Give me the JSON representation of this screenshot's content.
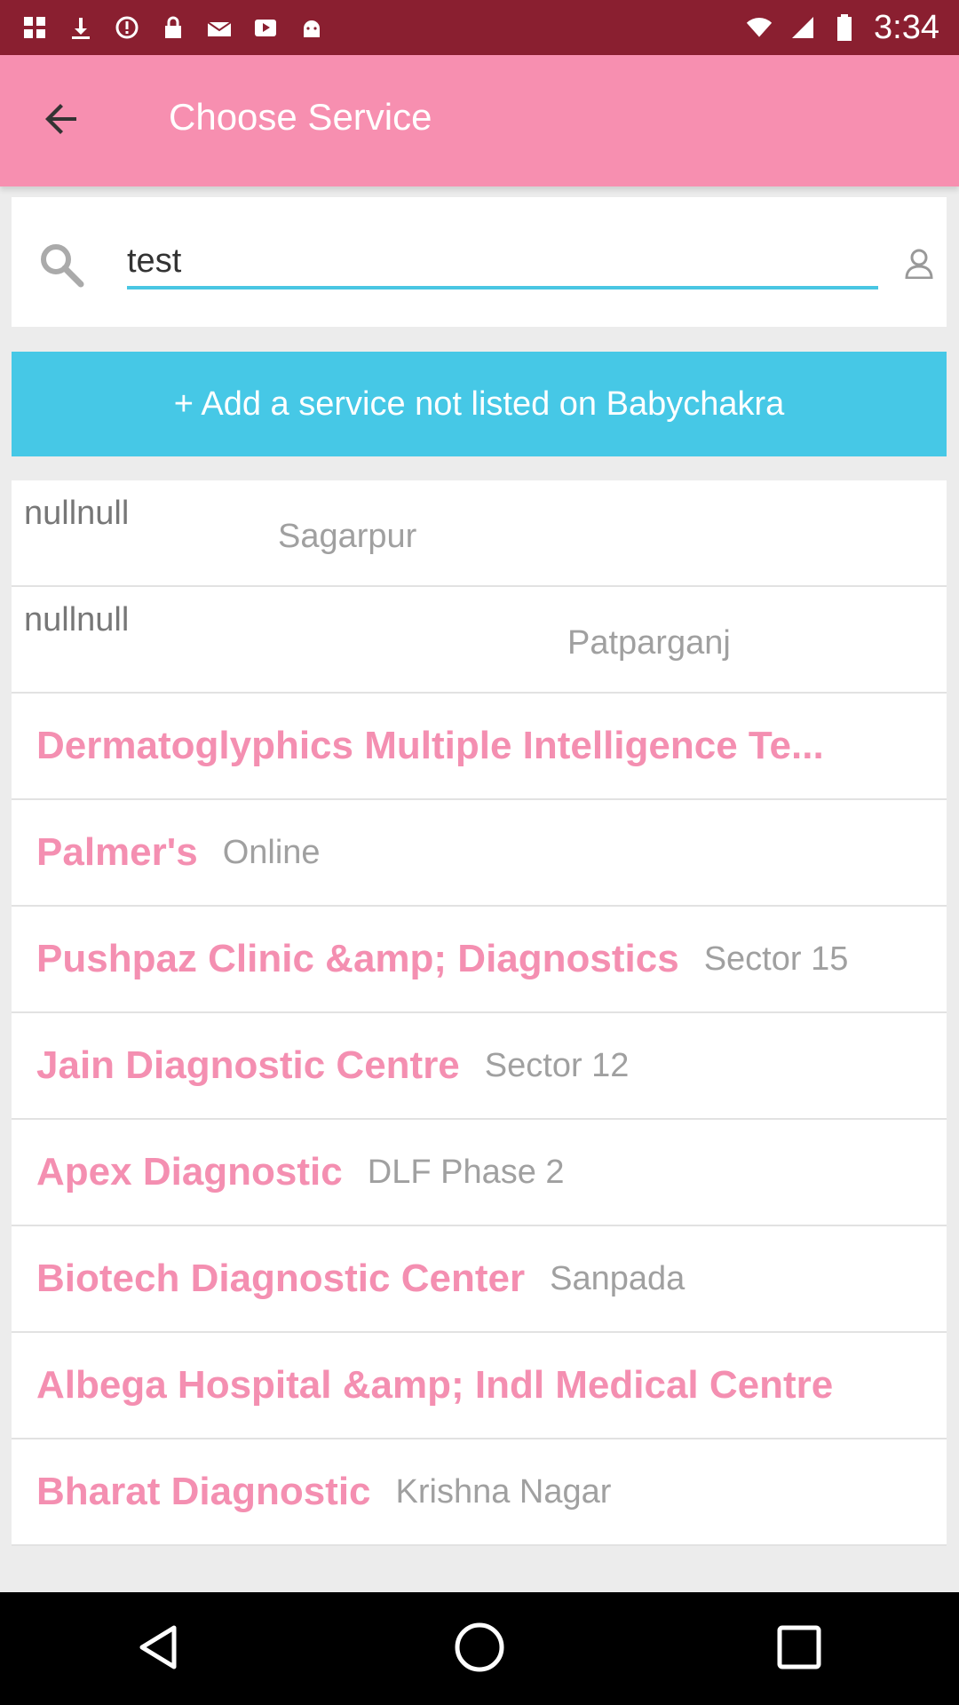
{
  "status_bar": {
    "time": "3:34",
    "icons": [
      "grid-icon",
      "download-icon",
      "warning-icon",
      "lock-icon",
      "mail-icon",
      "play-icon",
      "android-icon",
      "wifi-icon",
      "signal-icon",
      "battery-icon"
    ]
  },
  "app_bar": {
    "title": "Choose Service",
    "back_icon": "arrow-left-icon"
  },
  "search": {
    "value": "test",
    "placeholder": ""
  },
  "add_service_label": "+ Add a service not listed on Babychakra",
  "items": [
    {
      "name": "nullnull",
      "location": "Sagarpur"
    },
    {
      "name": "nullnull",
      "location": "Patparganj"
    },
    {
      "name": "Dermatoglyphics Multiple Intelligence Te...",
      "location": ""
    },
    {
      "name": "Palmer's",
      "location": "Online"
    },
    {
      "name": "Pushpaz Clinic &amp; Diagnostics",
      "location": "Sector 15"
    },
    {
      "name": "Jain Diagnostic Centre",
      "location": "Sector 12"
    },
    {
      "name": "Apex Diagnostic",
      "location": "DLF Phase 2"
    },
    {
      "name": "Biotech Diagnostic Center",
      "location": "Sanpada"
    },
    {
      "name": "Albega Hospital &amp; Indl Medical Centre",
      "location": ""
    },
    {
      "name": "Bharat Diagnostic",
      "location": "Krishna Nagar"
    }
  ],
  "colors": {
    "status_bar": "#8a1f30",
    "app_bar": "#f78fb0",
    "accent": "#46c8e6",
    "item_name": "#f48fb1",
    "item_location": "#a0a0a0"
  }
}
